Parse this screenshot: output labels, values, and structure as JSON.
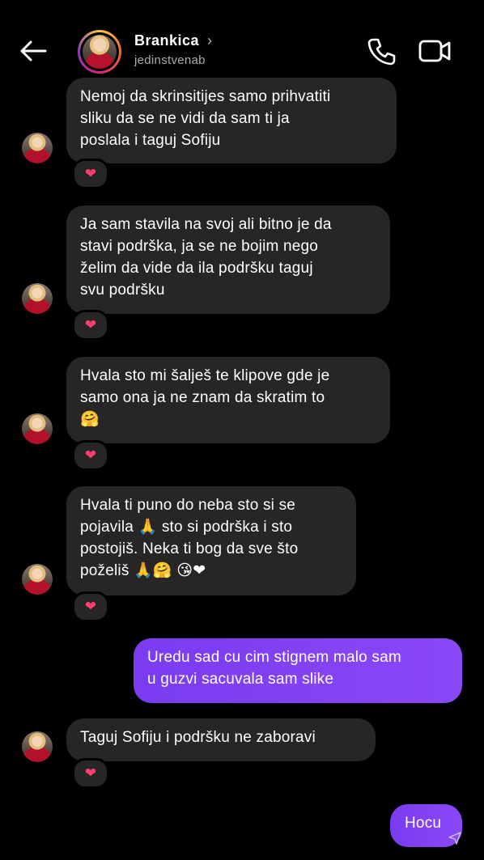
{
  "header": {
    "name": "Brankica",
    "chevron": "›",
    "username": "jedinstvenab",
    "icons": [
      "back-arrow-icon",
      "phone-icon",
      "video-camera-icon"
    ]
  },
  "messages": [
    {
      "direction": "in",
      "text": "Nemoj da skrinsitijes samo prihvatiti\nsliku da se ne vidi da sam ti ja\nposlala i taguj Sofiju",
      "reaction": "❤"
    },
    {
      "direction": "in",
      "text": "Ja sam stavila na svoj ali bitno je da\nstavi podrška, ja se ne bojim nego\nželim da vide da ila podršku taguj\nsvu podršku",
      "reaction": "❤"
    },
    {
      "direction": "in",
      "text": "Hvala sto mi šalješ te klipove gde je\nsamo ona ja ne znam da skratim to\n🤗",
      "reaction": "❤"
    },
    {
      "direction": "in",
      "text": "Hvala ti puno do neba sto si se\npojavila 🙏 sto si podrška i sto\npostojiš. Neka ti bog da sve što\npoželiš 🙏🤗 😘❤",
      "reaction": "❤"
    },
    {
      "direction": "out",
      "text": "Uredu sad cu cim stignem malo sam\nu guzvi sacuvala sam slike"
    },
    {
      "direction": "in",
      "text": "Taguj Sofiju i podršku ne zaboravi",
      "reaction": "❤"
    },
    {
      "direction": "out",
      "text": "Hocu"
    }
  ],
  "colors": {
    "background": "#000000",
    "incoming_bubble": "#262626",
    "outgoing_bubble": "#8145f5",
    "reaction_heart": "#ff3d6e"
  }
}
